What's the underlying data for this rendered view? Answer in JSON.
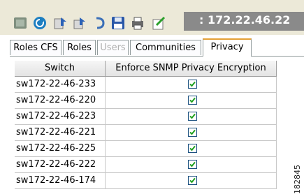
{
  "toolbar": {
    "icons": [
      "app-icon",
      "refresh-icon",
      "apply-icon",
      "undo-icon",
      "redo-icon",
      "save-icon",
      "print-icon",
      "export-icon"
    ],
    "title": ": 172.22.46.22"
  },
  "tabs": [
    {
      "label": "Roles CFS",
      "state": "normal"
    },
    {
      "label": "Roles",
      "state": "normal"
    },
    {
      "label": "Users",
      "state": "disabled"
    },
    {
      "label": "Communities",
      "state": "normal"
    },
    {
      "label": "Privacy",
      "state": "active"
    }
  ],
  "table": {
    "headers": [
      "Switch",
      "Enforce SNMP Privacy Encryption"
    ],
    "rows": [
      {
        "switch": "sw172-22-46-233",
        "enforce": true
      },
      {
        "switch": "sw172-22-46-220",
        "enforce": true
      },
      {
        "switch": "sw172-22-46-223",
        "enforce": true
      },
      {
        "switch": "sw172-22-46-221",
        "enforce": true
      },
      {
        "switch": "sw172-22-46-225",
        "enforce": true
      },
      {
        "switch": "sw172-22-46-222",
        "enforce": true
      },
      {
        "switch": "sw172-22-46-174",
        "enforce": true
      }
    ]
  },
  "figure_id": "182845",
  "colors": {
    "check": "#21a121",
    "tab_active_top": "#e4a033",
    "title_strip": "#8a8a8a"
  }
}
